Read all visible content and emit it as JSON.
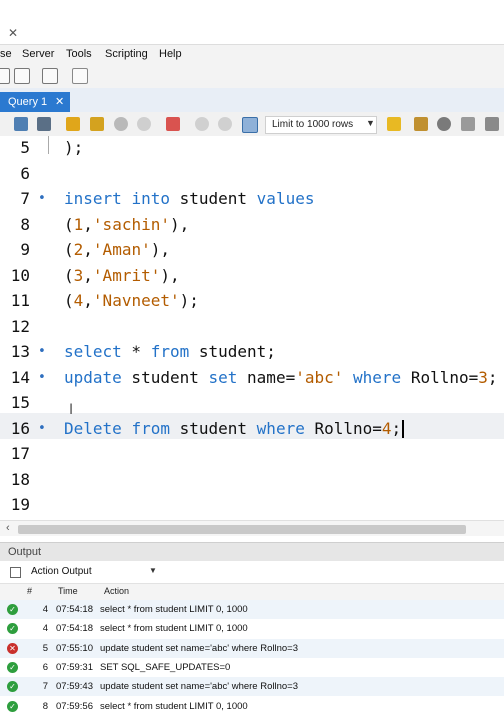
{
  "menu": {
    "items": [
      "se",
      "Server",
      "Tools",
      "Scripting",
      "Help"
    ]
  },
  "tab": {
    "label": "Query 1",
    "close": "✕"
  },
  "query_toolbar": {
    "limit_label": "Limit to 1000 rows"
  },
  "editor": {
    "lines": [
      {
        "num": "5",
        "marker": "",
        "tokens": [
          {
            "t": "plain",
            "v": ");"
          }
        ]
      },
      {
        "num": "6",
        "marker": "",
        "tokens": []
      },
      {
        "num": "7",
        "marker": "•",
        "tokens": [
          {
            "t": "kw",
            "v": "insert"
          },
          {
            "t": "plain",
            "v": " "
          },
          {
            "t": "kw",
            "v": "into"
          },
          {
            "t": "plain",
            "v": " student "
          },
          {
            "t": "kw",
            "v": "values"
          }
        ]
      },
      {
        "num": "8",
        "marker": "",
        "tokens": [
          {
            "t": "plain",
            "v": "("
          },
          {
            "t": "num",
            "v": "1"
          },
          {
            "t": "plain",
            "v": ","
          },
          {
            "t": "str",
            "v": "'sachin'"
          },
          {
            "t": "plain",
            "v": "),"
          }
        ]
      },
      {
        "num": "9",
        "marker": "",
        "tokens": [
          {
            "t": "plain",
            "v": "("
          },
          {
            "t": "num",
            "v": "2"
          },
          {
            "t": "plain",
            "v": ","
          },
          {
            "t": "str",
            "v": "'Aman'"
          },
          {
            "t": "plain",
            "v": "),"
          }
        ]
      },
      {
        "num": "10",
        "marker": "",
        "tokens": [
          {
            "t": "plain",
            "v": "("
          },
          {
            "t": "num",
            "v": "3"
          },
          {
            "t": "plain",
            "v": ","
          },
          {
            "t": "str",
            "v": "'Amrit'"
          },
          {
            "t": "plain",
            "v": "),"
          }
        ]
      },
      {
        "num": "11",
        "marker": "",
        "tokens": [
          {
            "t": "plain",
            "v": "("
          },
          {
            "t": "num",
            "v": "4"
          },
          {
            "t": "plain",
            "v": ","
          },
          {
            "t": "str",
            "v": "'Navneet'"
          },
          {
            "t": "plain",
            "v": ");"
          }
        ]
      },
      {
        "num": "12",
        "marker": "",
        "tokens": []
      },
      {
        "num": "13",
        "marker": "•",
        "tokens": [
          {
            "t": "kw",
            "v": "select"
          },
          {
            "t": "plain",
            "v": " * "
          },
          {
            "t": "kw",
            "v": "from"
          },
          {
            "t": "plain",
            "v": " student;"
          }
        ]
      },
      {
        "num": "14",
        "marker": "•",
        "tokens": [
          {
            "t": "kw",
            "v": "update"
          },
          {
            "t": "plain",
            "v": " student "
          },
          {
            "t": "kw",
            "v": "set"
          },
          {
            "t": "plain",
            "v": " name="
          },
          {
            "t": "str",
            "v": "'abc'"
          },
          {
            "t": "plain",
            "v": " "
          },
          {
            "t": "kw",
            "v": "where"
          },
          {
            "t": "plain",
            "v": " Rollno="
          },
          {
            "t": "num",
            "v": "3"
          },
          {
            "t": "plain",
            "v": ";"
          }
        ]
      },
      {
        "num": "15",
        "marker": "",
        "tokens": []
      },
      {
        "num": "16",
        "marker": "•",
        "current": true,
        "tokens": [
          {
            "t": "kw",
            "v": "Delete"
          },
          {
            "t": "plain",
            "v": " "
          },
          {
            "t": "kw",
            "v": "from"
          },
          {
            "t": "plain",
            "v": " student "
          },
          {
            "t": "kw",
            "v": "where"
          },
          {
            "t": "plain",
            "v": " Rollno="
          },
          {
            "t": "num",
            "v": "4"
          },
          {
            "t": "plain",
            "v": ";"
          }
        ]
      },
      {
        "num": "17",
        "marker": "",
        "tokens": []
      },
      {
        "num": "18",
        "marker": "",
        "tokens": []
      },
      {
        "num": "19",
        "marker": "",
        "tokens": []
      }
    ]
  },
  "output": {
    "header": "Output",
    "selector": "Action Output",
    "columns": {
      "num": "#",
      "time": "Time",
      "action": "Action"
    },
    "rows": [
      {
        "status": "ok",
        "num": "4",
        "time": "07:54:18",
        "action": "select * from student LIMIT 0, 1000"
      },
      {
        "status": "ok",
        "num": "4",
        "time": "07:54:18",
        "action": "select * from student LIMIT 0, 1000"
      },
      {
        "status": "error",
        "num": "5",
        "time": "07:55:10",
        "action": "update student set name='abc' where Rollno=3"
      },
      {
        "status": "ok",
        "num": "6",
        "time": "07:59:31",
        "action": "SET SQL_SAFE_UPDATES=0"
      },
      {
        "status": "ok",
        "num": "7",
        "time": "07:59:43",
        "action": "update student set name='abc' where Rollno=3"
      },
      {
        "status": "ok",
        "num": "8",
        "time": "07:59:56",
        "action": "select * from student LIMIT 0, 1000"
      }
    ]
  },
  "colors": {
    "keyword": "#2372c8",
    "string": "#b35c00",
    "ok": "#2e9e3e",
    "error": "#c9302c",
    "tab": "#2b79d0"
  }
}
